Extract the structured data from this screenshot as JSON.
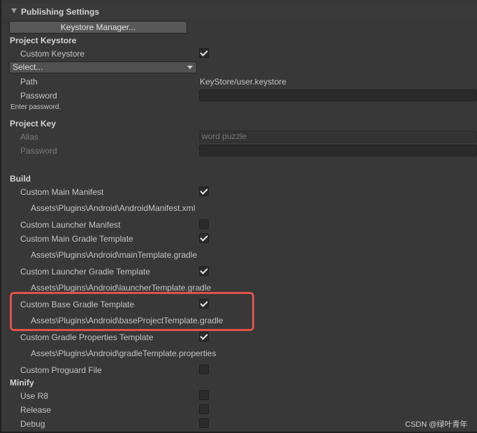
{
  "panel": {
    "title": "Publishing Settings",
    "keystore_manager_button": "Keystore Manager..."
  },
  "project_keystore": {
    "heading": "Project Keystore",
    "custom_keystore_label": "Custom Keystore",
    "custom_keystore_checked": true,
    "select_value": "Select...",
    "path_label": "Path",
    "path_value": "KeyStore/user.keystore",
    "password_label": "Password",
    "password_hint": "Enter password."
  },
  "project_key": {
    "heading": "Project Key",
    "alias_label": "Alias",
    "alias_value": "word puzzle",
    "password_label": "Password"
  },
  "build": {
    "heading": "Build",
    "items": [
      {
        "label": "Custom Main Manifest",
        "checked": true,
        "path": "Assets\\Plugins\\Android\\AndroidManifest.xml"
      },
      {
        "label": "Custom Launcher Manifest",
        "checked": false,
        "path": ""
      },
      {
        "label": "Custom Main Gradle Template",
        "checked": true,
        "path": "Assets\\Plugins\\Android\\mainTemplate.gradle"
      },
      {
        "label": "Custom Launcher Gradle Template",
        "checked": true,
        "path": "Assets\\Plugins\\Android\\launcherTemplate.gradle"
      },
      {
        "label": "Custom Base Gradle Template",
        "checked": true,
        "path": "Assets\\Plugins\\Android\\baseProjectTemplate.gradle"
      },
      {
        "label": "Custom Gradle Properties Template",
        "checked": true,
        "path": "Assets\\Plugins\\Android\\gradleTemplate.properties"
      },
      {
        "label": "Custom Proguard File",
        "checked": false,
        "path": ""
      }
    ]
  },
  "minify": {
    "heading": "Minify",
    "items": [
      {
        "label": "Use R8",
        "checked": false
      },
      {
        "label": "Release",
        "checked": false
      },
      {
        "label": "Debug",
        "checked": false
      }
    ]
  },
  "watermark": "CSDN @绿叶青年",
  "colors": {
    "background": "#383838",
    "highlight": "#e0524a",
    "field": "#2a2a2a"
  }
}
